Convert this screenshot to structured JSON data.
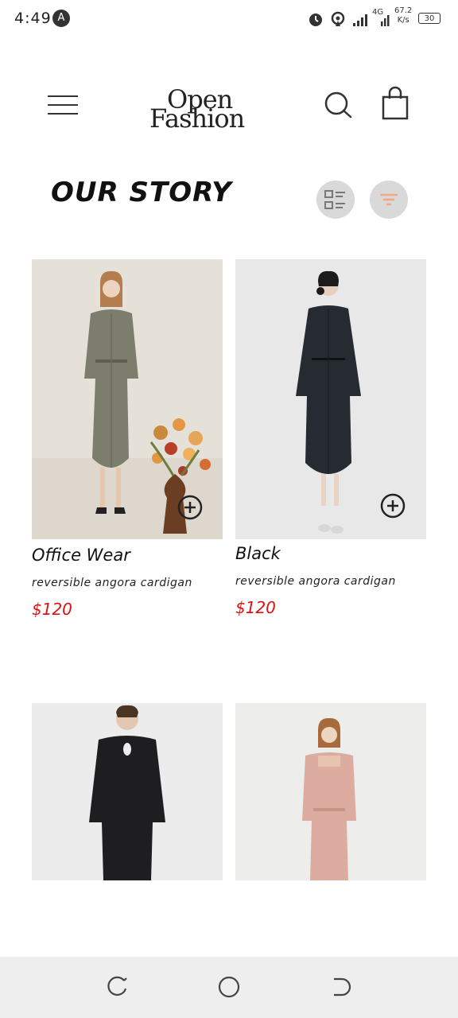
{
  "status_bar": {
    "time": "4:49",
    "notification_letter": "A",
    "network_type": "4G",
    "net_speed_value": "67.2",
    "net_speed_unit": "K/s",
    "battery": "30"
  },
  "header": {
    "logo_line1": "Open",
    "logo_line2": "Fashion"
  },
  "section": {
    "title": "OUR STORY",
    "filter_accent": "#f4a582"
  },
  "products": [
    {
      "name": "Office Wear",
      "description": "reversible angora cardigan",
      "price": "$120"
    },
    {
      "name": "Black",
      "description": "reversible angora cardigan",
      "price": "$120"
    },
    {
      "name": "",
      "description": "",
      "price": ""
    },
    {
      "name": "",
      "description": "",
      "price": ""
    }
  ],
  "colors": {
    "price": "#dd1111",
    "icon_bg": "#d9d9d9",
    "nav_bg": "#eeeeee"
  }
}
